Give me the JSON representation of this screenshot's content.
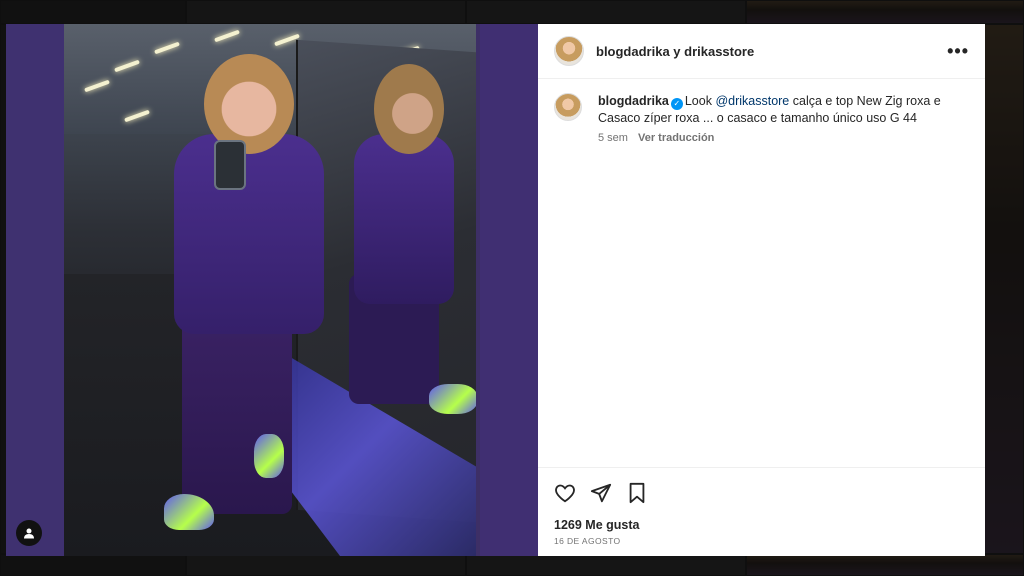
{
  "post": {
    "header_title": "blogdadrika y drikasstore",
    "more_icon": "more-horizontal-icon",
    "caption": {
      "username": "blogdadrika",
      "verified_icon": "verified-badge-icon",
      "text_before_mention": "Look ",
      "mention": "@drikasstore",
      "text_after_mention": " calça e top New Zig roxa e Casaco zíper roxa ... o casaco e tamanho único uso G 44",
      "time_ago": "5 sem",
      "translate_label": "Ver traducción"
    },
    "actions": {
      "like_icon": "heart-icon",
      "share_icon": "send-icon",
      "save_icon": "bookmark-icon"
    },
    "likes_text": "1269 Me gusta",
    "date_text": "16 DE AGOSTO"
  },
  "media": {
    "tag_users_icon": "user-icon"
  },
  "colors": {
    "mention": "#00376b",
    "verified": "#0095f6",
    "modal_bg": "#3d2f66"
  }
}
